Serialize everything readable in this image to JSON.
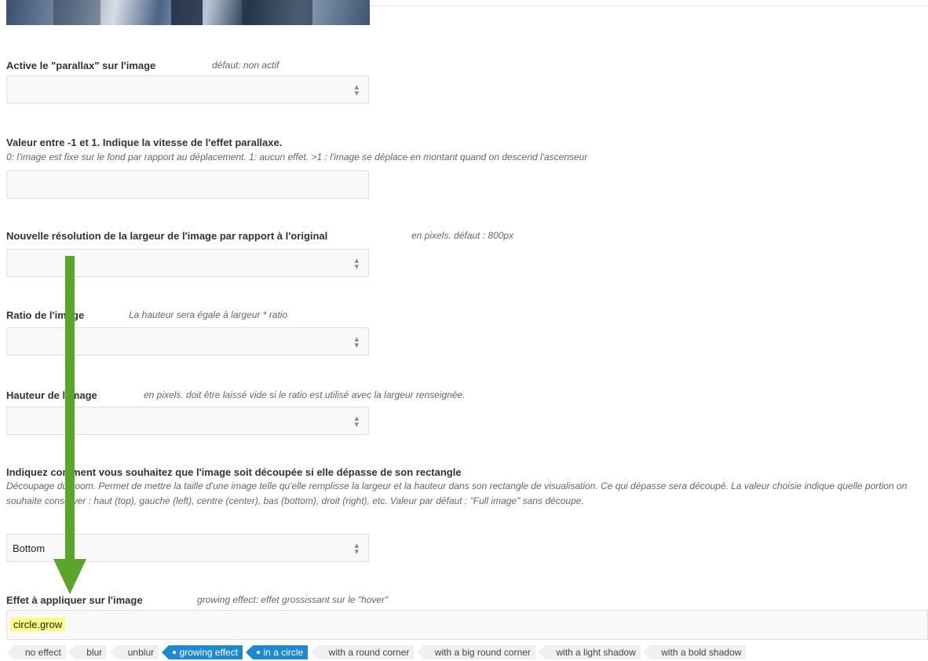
{
  "parallax": {
    "label": "Active le \"parallax\" sur l'image",
    "hint": "défaut: non actif",
    "value": ""
  },
  "speed": {
    "label": "Valeur entre -1 et 1. Indique la vitesse de l'effet parallaxe.",
    "description": "0: l'image est fixe sur le fond par rapport au déplacement. 1: aucun effet. >1 : l'image se déplace en montant quand on descend l'ascenseur",
    "value": ""
  },
  "resolution": {
    "label": "Nouvelle résolution de la largeur de l'image par rapport à l'original",
    "hint": "en pixels. défaut : 800px",
    "value": ""
  },
  "ratio": {
    "label": "Ratio de l'image",
    "hint": "La hauteur sera égale à largeur * ratio",
    "value": ""
  },
  "height": {
    "label": "Hauteur de l'image",
    "hint": "en pixels. doit être laissé vide si le ratio est utilisé avec la largeur renseignée.",
    "value": ""
  },
  "crop": {
    "label": "Indiquez comment vous souhaitez que l'image soit découpée si elle dépasse de son rectangle",
    "description": "Découpage du zoom. Permet de mettre la taille d'une image telle qu'elle remplisse la largeur et la hauteur dans son rectangle de visualisation. Ce qui dépasse sera découpé. La valeur choisie indique quelle portion on souhaite conserver : haut (top), gauche (left), centre (center), bas (bottom), droit (right), etc. Valeur par défaut : \"Full image\" sans découpe.",
    "value": "Bottom"
  },
  "effect": {
    "label": "Effet à appliquer sur l'image",
    "hint": "growing effect: effet grossissant sur le \"hover\"",
    "value": "circle.grow",
    "tags": [
      {
        "label": "no effect",
        "selected": false
      },
      {
        "label": "blur",
        "selected": false
      },
      {
        "label": "unblur",
        "selected": false
      },
      {
        "label": "growing effect",
        "selected": true
      },
      {
        "label": "in a circle",
        "selected": true
      },
      {
        "label": "with a round corner",
        "selected": false
      },
      {
        "label": "with a big round corner",
        "selected": false
      },
      {
        "label": "with a light shadow",
        "selected": false
      },
      {
        "label": "with a bold shadow",
        "selected": false
      }
    ]
  },
  "colors": {
    "arrow": "#5aa52a",
    "highlight": "#fbfb7e",
    "tag_selected": "#1e88d0"
  },
  "icons": {
    "select_arrows": "sort-arrows-icon",
    "annotation": "down-arrow-icon"
  }
}
